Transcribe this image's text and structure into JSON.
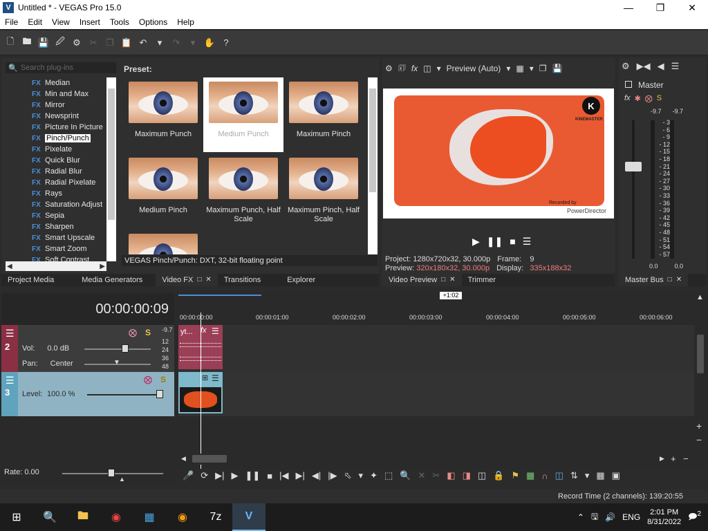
{
  "window": {
    "title": "Untitled * - VEGAS Pro 15.0",
    "logo_letter": "V"
  },
  "menu": [
    "File",
    "Edit",
    "View",
    "Insert",
    "Tools",
    "Options",
    "Help"
  ],
  "plugins": {
    "search_placeholder": "Search plug-ins",
    "items": [
      "Median",
      "Min and Max",
      "Mirror",
      "Newsprint",
      "Picture In Picture",
      "Pinch/Punch",
      "Pixelate",
      "Quick Blur",
      "Radial Blur",
      "Radial Pixelate",
      "Rays",
      "Saturation Adjust",
      "Sepia",
      "Sharpen",
      "Smart Upscale",
      "Smart Zoom",
      "Soft Contrast"
    ],
    "selected": "Pinch/Punch",
    "badge": "FX"
  },
  "presets": {
    "label": "Preset:",
    "items": [
      "Maximum Punch",
      "Medium Punch",
      "Maximum Pinch",
      "Medium Pinch",
      "Maximum Punch, Half Scale",
      "Maximum Pinch, Half Scale"
    ],
    "selected_index": 1,
    "description": "VEGAS Pinch/Punch: DXT, 32-bit floating point"
  },
  "left_tabs": [
    "Project Media",
    "Media Generators",
    "Video FX",
    "Transitions",
    "Explorer"
  ],
  "preview": {
    "mode": "Preview (Auto)",
    "watermark_logo": "K",
    "watermark_text": "KINEMASTER",
    "recorded_text": "Recorded by",
    "powerdirector_text": "PowerDirector",
    "project_label": "Project:",
    "project_value": "1280x720x32, 30.000p",
    "frame_label": "Frame:",
    "frame_value": "9",
    "preview_label": "Preview:",
    "preview_value": "320x180x32, 30.000p",
    "display_label": "Display:",
    "display_value": "335x188x32",
    "tabs": [
      "Video Preview",
      "Trimmer"
    ]
  },
  "master": {
    "label": "Master",
    "peak_left": "-9.7",
    "peak_right": "-9.7",
    "scale": [
      "3",
      "6",
      "9",
      "12",
      "15",
      "18",
      "21",
      "24",
      "27",
      "30",
      "33",
      "36",
      "39",
      "42",
      "45",
      "48",
      "51",
      "54",
      "57"
    ],
    "bottom_left": "0.0",
    "bottom_right": "0.0",
    "tab": "Master Bus"
  },
  "timeline": {
    "timecode": "00:00:00:09",
    "loop_label": "+1:02",
    "ruler": [
      "00:00:00:00",
      "00:00:01:00",
      "00:00:02:00",
      "00:00:03:00",
      "00:00:04:00",
      "00:00:05:00",
      "00:00:06:00"
    ],
    "audio_track": {
      "number": "2",
      "peak": "-9.7",
      "vol_label": "Vol:",
      "vol_value": "0.0 dB",
      "pan_label": "Pan:",
      "pan_value": "Center",
      "db_marks": [
        "12",
        "24",
        "36",
        "48"
      ],
      "clip_label": "yt..."
    },
    "video_track": {
      "number": "3",
      "level_label": "Level:",
      "level_value": "100.0 %"
    },
    "rate_label": "Rate: 0.00"
  },
  "status": {
    "record_time": "Record Time (2 channels): 139:20:55"
  },
  "taskbar": {
    "language": "ENG",
    "time": "2:01 PM",
    "date": "8/31/2022",
    "notifications": "2"
  }
}
